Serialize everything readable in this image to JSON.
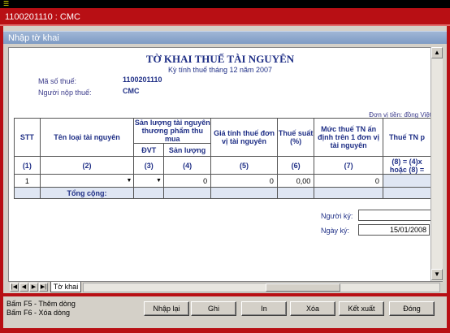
{
  "window": {
    "title": "1100201110 : CMC",
    "icon_glyph": "☰"
  },
  "subwindow": {
    "title": "Nhập tờ khai"
  },
  "form": {
    "title": "TỜ KHAI THUẾ TÀI NGUYÊN",
    "period": "Kỳ tính thuế tháng 12 năm 2007",
    "tax_id_label": "Mã số thuế:",
    "tax_id_value": "1100201110",
    "taxpayer_label": "Người nộp thuế:",
    "taxpayer_value": "CMC",
    "currency_note": "Đơn vị tiền: đồng Việt"
  },
  "table": {
    "headers": {
      "stt": "STT",
      "resource_name": "Tên loại tài nguyên",
      "output_group": "Sản lượng tài nguyên thương phẩm thu mua",
      "unit": "ĐVT",
      "quantity": "Sản lượng",
      "unit_price": "Giá tính thuế đơn vị tài nguyên",
      "tax_rate": "Thuế suất (%)",
      "fixed_tax": "Mức thuế TN ấn định trên 1 đơn vị tài nguyên",
      "resource_tax": "Thuế TN p"
    },
    "column_numbers": [
      "(1)",
      "(2)",
      "(3)",
      "(4)",
      "(5)",
      "(6)",
      "(7)"
    ],
    "formula_line1": "(8) = (4)x",
    "formula_line2": "hoặc (8) =",
    "rows": [
      {
        "stt": "1",
        "resource_name": "",
        "unit": "",
        "quantity": "0",
        "unit_price": "0",
        "tax_rate": "0,00",
        "fixed_tax": "0",
        "resource_tax": ""
      }
    ],
    "total_label": "Tổng cộng:"
  },
  "signature": {
    "signer_label": "Người ký:",
    "signer_value": "",
    "date_label": "Ngày ký:",
    "date_value": "15/01/2008"
  },
  "sheet_tab": {
    "label": "Tờ khai"
  },
  "hints": {
    "f5": "Bấm F5 - Thêm dòng",
    "f6": "Bấm F6 - Xóa dòng"
  },
  "buttons": {
    "reset": "Nhập lại",
    "save": "Ghi",
    "print": "In",
    "delete": "Xóa",
    "export": "Kết xuất",
    "close": "Đóng"
  },
  "colors": {
    "title_bar": "#b80f14",
    "subwindow_bar": "#7e9bc4",
    "form_text": "#1f2f86",
    "row_highlight": "#dfe6f3"
  }
}
